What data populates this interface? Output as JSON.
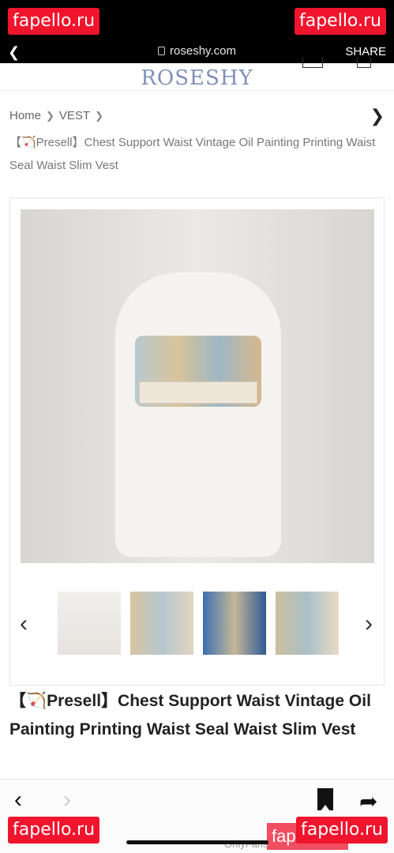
{
  "status": {
    "url": "roseshy.com",
    "share": "SHARE"
  },
  "watermarks": {
    "top_left": "fapello.ru",
    "top_right": "fapello.ru",
    "bottom_left": "fapello.ru",
    "bottom_right": "fapello.ru",
    "bottom_right_overlay": "fapello.ru",
    "faint": "OnlyFans"
  },
  "site": {
    "logo": "ROSESHY"
  },
  "breadcrumb": {
    "home": "Home",
    "category": "VEST",
    "current": "【🏹Presell】Chest Support Waist Vintage Oil Painting Printing Waist Seal Waist Slim Vest"
  },
  "product": {
    "title": "【🏹Presell】Chest Support Waist Vintage Oil Painting Printing Waist Seal Waist Slim Vest",
    "thumbnail_count": 4
  },
  "icons": {
    "back": "chevron-left-icon",
    "forward": "chevron-right-icon",
    "bookmark": "bookmark-icon",
    "share": "share-arrow-icon",
    "lock": "lock-icon"
  },
  "colors": {
    "watermark": "#f0142d",
    "logo": "#7f8fb7"
  }
}
